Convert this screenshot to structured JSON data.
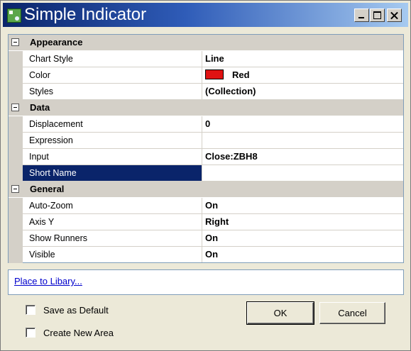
{
  "window": {
    "title": "Simple Indicator"
  },
  "property_grid": {
    "categories": [
      {
        "label": "Appearance",
        "properties": [
          {
            "name": "Chart Style",
            "value": "Line"
          },
          {
            "name": "Color",
            "value": "Red",
            "swatch_color": "#e01212"
          },
          {
            "name": "Styles",
            "value": "(Collection)"
          }
        ]
      },
      {
        "label": "Data",
        "properties": [
          {
            "name": "Displacement",
            "value": "0"
          },
          {
            "name": "Expression",
            "value": ""
          },
          {
            "name": "Input",
            "value": "Close:ZBH8"
          },
          {
            "name": "Short Name",
            "value": "",
            "selected": true
          }
        ]
      },
      {
        "label": "General",
        "properties": [
          {
            "name": "Auto-Zoom",
            "value": "On"
          },
          {
            "name": "Axis Y",
            "value": "Right"
          },
          {
            "name": "Show Runners",
            "value": "On"
          },
          {
            "name": "Visible",
            "value": "On"
          }
        ]
      }
    ]
  },
  "link": {
    "label": "Place to Libary..."
  },
  "options": {
    "save_default": {
      "label": "Save as Default",
      "checked": false
    },
    "create_area": {
      "label": "Create New Area",
      "checked": false
    }
  },
  "buttons": {
    "ok": "OK",
    "cancel": "Cancel"
  },
  "colors": {
    "titlebar_start": "#0a246a",
    "titlebar_end": "#a6caf0",
    "selection": "#0a246a"
  }
}
